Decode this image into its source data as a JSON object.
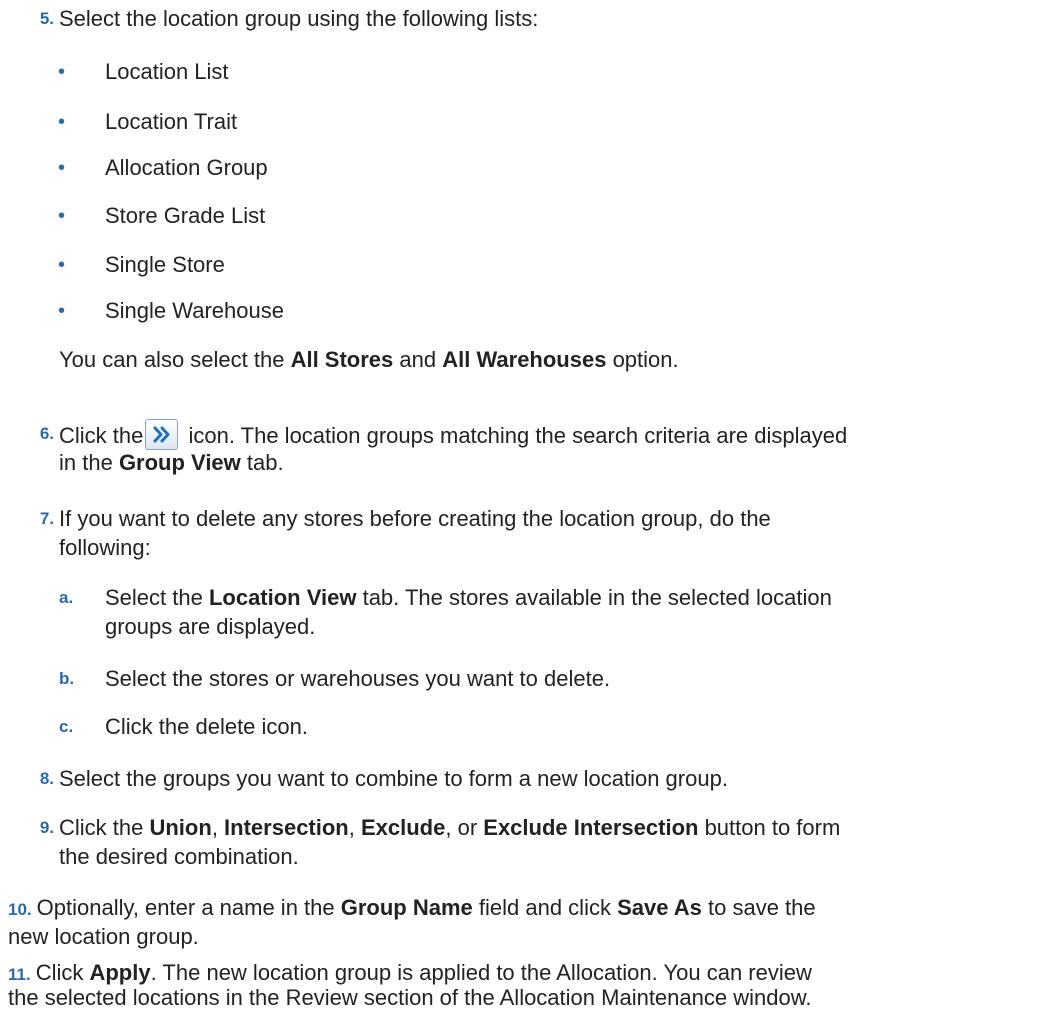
{
  "colors": {
    "accent": "#2b69a8",
    "text": "#222222"
  },
  "step5": {
    "number": "5.",
    "text": "Select the location group using the following lists:",
    "bullets": [
      "Location List",
      "Location Trait",
      "Allocation Group",
      "Store Grade List",
      "Single Store",
      "Single Warehouse"
    ],
    "note_pre": "You can also select the ",
    "note_b1": "All Stores",
    "note_mid": " and ",
    "note_b2": "All Warehouses",
    "note_post": " option."
  },
  "step6": {
    "number": "6.",
    "pre": "Click the",
    "icon": "double-chevron-right-icon",
    "post": " icon. The location groups matching the search criteria are displayed",
    "line2_pre": "in the ",
    "line2_b": "Group View",
    "line2_post": " tab."
  },
  "step7": {
    "number": "7.",
    "line1": "If you want to delete any stores before creating the location group, do the",
    "line2": "following:",
    "substeps": {
      "a": {
        "letter": "a.",
        "pre": "Select the ",
        "b": "Location View",
        "post": " tab. The stores available in the selected location",
        "line2": "groups are displayed."
      },
      "b": {
        "letter": "b.",
        "text": "Select the stores or warehouses you want to delete."
      },
      "c": {
        "letter": "c.",
        "text": "Click the delete icon."
      }
    }
  },
  "step8": {
    "number": "8.",
    "text": "Select the groups you want to combine to form a new location group."
  },
  "step9": {
    "number": "9.",
    "pre": "Click the ",
    "b1": "Union",
    "sep1": ", ",
    "b2": "Intersection",
    "sep2": ", ",
    "b3": "Exclude",
    "sep3": ", or ",
    "b4": "Exclude Intersection",
    "post": " button to form",
    "line2": "the desired combination."
  },
  "step10": {
    "number": "10.",
    "pre": "Optionally, enter a name in the ",
    "b1": "Group Name",
    "mid": " field and click ",
    "b2": "Save As",
    "post": " to save the",
    "line2": "new location group."
  },
  "step11": {
    "number": "11.",
    "pre": "Click ",
    "b": "Apply",
    "post": ". The new location group is applied to the Allocation. You can review",
    "line2": "the selected locations in the Review section of the Allocation Maintenance window."
  }
}
